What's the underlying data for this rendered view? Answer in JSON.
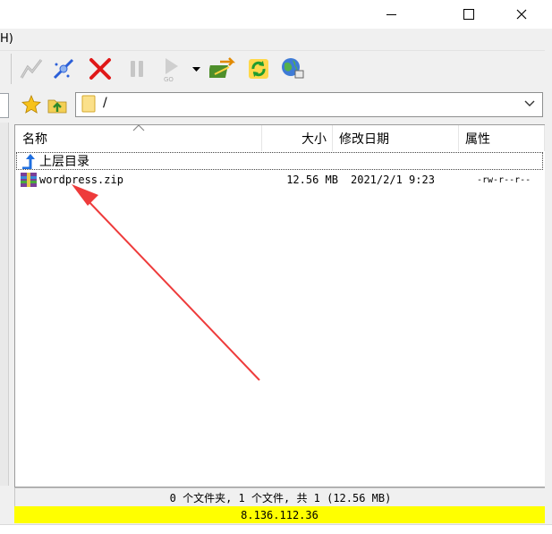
{
  "window": {
    "minimize_glyph": "—",
    "maximize_glyph": "☐",
    "close_glyph": "✕"
  },
  "menubar": {
    "fragment": "H)"
  },
  "toolbar": {
    "icons": [
      "connect-icon",
      "quick-connect-icon",
      "disconnect-icon",
      "pause-icon",
      "go-icon",
      "dropdown-arrow-icon",
      "transfer-icon",
      "refresh-icon",
      "site-manager-icon"
    ]
  },
  "address": {
    "path": "/"
  },
  "columns": {
    "name": "名称",
    "size": "大小",
    "modified": "修改日期",
    "attributes": "属性"
  },
  "rows": [
    {
      "name": "上层目录",
      "size": "",
      "modified": "",
      "attributes": ""
    },
    {
      "name": "wordpress.zip",
      "size": "12.56 MB",
      "modified": "2021/2/1 9:23",
      "attributes": "-rw-r--r--"
    }
  ],
  "status": {
    "summary": "0 个文件夹, 1 个文件, 共 1 (12.56 MB)",
    "host": "8.136.112.36"
  },
  "colors": {
    "host_bar": "#ffff00",
    "annotation_arrow": "#ee3b3b"
  }
}
